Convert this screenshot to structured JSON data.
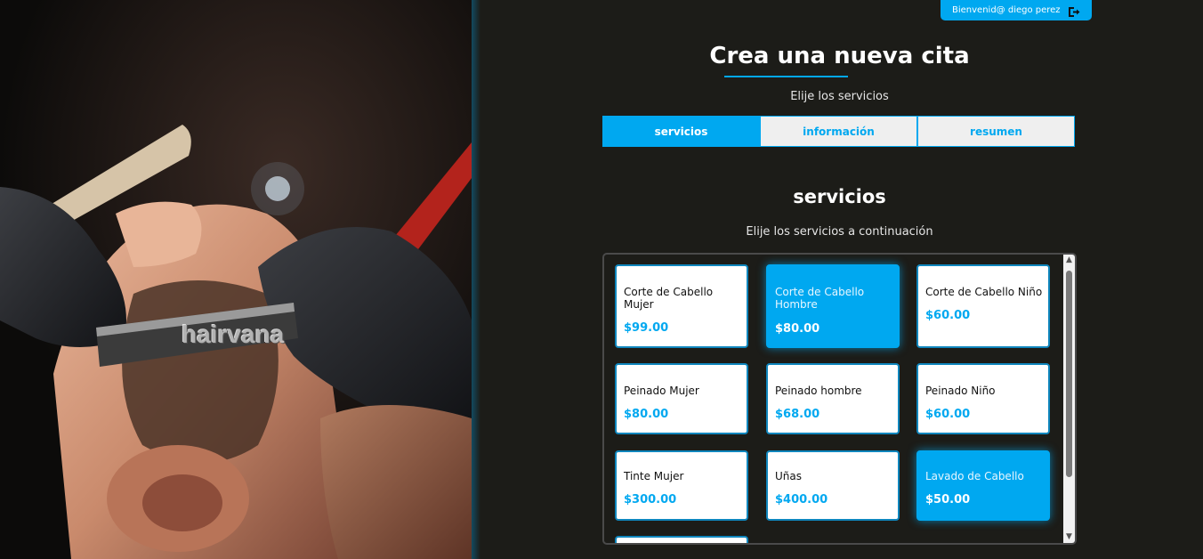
{
  "hero": {
    "watermark": "hairvana"
  },
  "header": {
    "welcome_text": "Bienvenid@ diego perez",
    "logout_icon": "logout-icon"
  },
  "page": {
    "title": "Crea una nueva cita",
    "subtitle": "Elije los servicios"
  },
  "tabs": [
    {
      "label": "servicios",
      "active": true
    },
    {
      "label": "información",
      "active": false
    },
    {
      "label": "resumen",
      "active": false
    }
  ],
  "services_section": {
    "title": "servicios",
    "subtitle": "Elije los servicios a continuación",
    "items": [
      {
        "name": "Corte de Cabello Mujer",
        "price": "$99.00",
        "selected": false
      },
      {
        "name": "Corte de Cabello Hombre",
        "price": "$80.00",
        "selected": true
      },
      {
        "name": "Corte de Cabello Niño",
        "price": "$60.00",
        "selected": false
      },
      {
        "name": "Peinado Mujer",
        "price": "$80.00",
        "selected": false
      },
      {
        "name": "Peinado hombre",
        "price": "$68.00",
        "selected": false
      },
      {
        "name": "Peinado Niño",
        "price": "$60.00",
        "selected": false
      },
      {
        "name": "Tinte Mujer",
        "price": "$300.00",
        "selected": false
      },
      {
        "name": "Uñas",
        "price": "$400.00",
        "selected": false
      },
      {
        "name": "Lavado de Cabello",
        "price": "$50.00",
        "selected": true
      }
    ]
  },
  "colors": {
    "accent": "#00a8f0",
    "background": "#1c1c18"
  }
}
